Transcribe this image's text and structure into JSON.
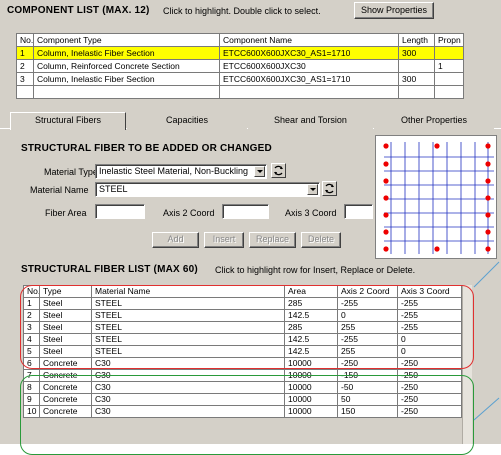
{
  "component_list": {
    "title": "COMPONENT LIST (MAX. 12)",
    "hint": "Click to highlight.  Double click to select.",
    "show_properties_label": "Show Properties",
    "columns": [
      "No.",
      "Component Type",
      "Component Name",
      "Length",
      "Propn"
    ],
    "rows": [
      {
        "no": "1",
        "type": "Column, Inelastic Fiber Section",
        "name": "ETCC600X600JXC30_AS1=1710",
        "length": "300",
        "propn": ""
      },
      {
        "no": "2",
        "type": "Column, Reinforced Concrete Section",
        "name": "ETCC600X600JXC30",
        "length": "",
        "propn": "1"
      },
      {
        "no": "3",
        "type": "Column, Inelastic Fiber Section",
        "name": "ETCC600X600JXC30_AS1=1710",
        "length": "300",
        "propn": ""
      }
    ]
  },
  "tabs": [
    "Structural Fibers",
    "Capacities",
    "Shear and Torsion",
    "Other Properties"
  ],
  "fiber_form": {
    "title": "STRUCTURAL FIBER TO BE ADDED OR CHANGED",
    "material_type_label": "Material Type",
    "material_type_value": "Inelastic Steel Material, Non-Buckling",
    "material_name_label": "Material Name",
    "material_name_value": "STEEL",
    "fiber_area_label": "Fiber Area",
    "axis2_label": "Axis 2 Coord",
    "axis3_label": "Axis 3 Coord",
    "buttons": {
      "add": "Add",
      "insert": "Insert",
      "replace": "Replace",
      "delete": "Delete"
    }
  },
  "fiber_list": {
    "title": "STRUCTURAL FIBER LIST  (MAX 60)",
    "hint": "Click to highlight row for Insert, Replace or Delete.",
    "columns": [
      "No.",
      "Type",
      "Material Name",
      "Area",
      "Axis 2 Coord",
      "Axis 3 Coord"
    ],
    "rows": [
      {
        "no": "1",
        "type": "Steel",
        "material": "STEEL",
        "area": "285",
        "axis2": "-255",
        "axis3": "-255"
      },
      {
        "no": "2",
        "type": "Steel",
        "material": "STEEL",
        "area": "142.5",
        "axis2": "0",
        "axis3": "-255"
      },
      {
        "no": "3",
        "type": "Steel",
        "material": "STEEL",
        "area": "285",
        "axis2": "255",
        "axis3": "-255"
      },
      {
        "no": "4",
        "type": "Steel",
        "material": "STEEL",
        "area": "142.5",
        "axis2": "-255",
        "axis3": "0"
      },
      {
        "no": "5",
        "type": "Steel",
        "material": "STEEL",
        "area": "142.5",
        "axis2": "255",
        "axis3": "0"
      },
      {
        "no": "6",
        "type": "Concrete",
        "material": "C30",
        "area": "10000",
        "axis2": "-250",
        "axis3": "-250"
      },
      {
        "no": "7",
        "type": "Concrete",
        "material": "C30",
        "area": "10000",
        "axis2": "-150",
        "axis3": "-250"
      },
      {
        "no": "8",
        "type": "Concrete",
        "material": "C30",
        "area": "10000",
        "axis2": "-50",
        "axis3": "-250"
      },
      {
        "no": "9",
        "type": "Concrete",
        "material": "C30",
        "area": "10000",
        "axis2": "50",
        "axis3": "-250"
      },
      {
        "no": "10",
        "type": "Concrete",
        "material": "C30",
        "area": "10000",
        "axis2": "150",
        "axis3": "-250"
      }
    ]
  },
  "colors": {
    "panel": "#d4d0c8",
    "highlight_row": "#ffff00",
    "steel_group_outline": "#e03030",
    "concrete_group_outline": "#2a9a3a",
    "fiber_dot": "#ee0000",
    "section_grid": "#2030c0"
  }
}
